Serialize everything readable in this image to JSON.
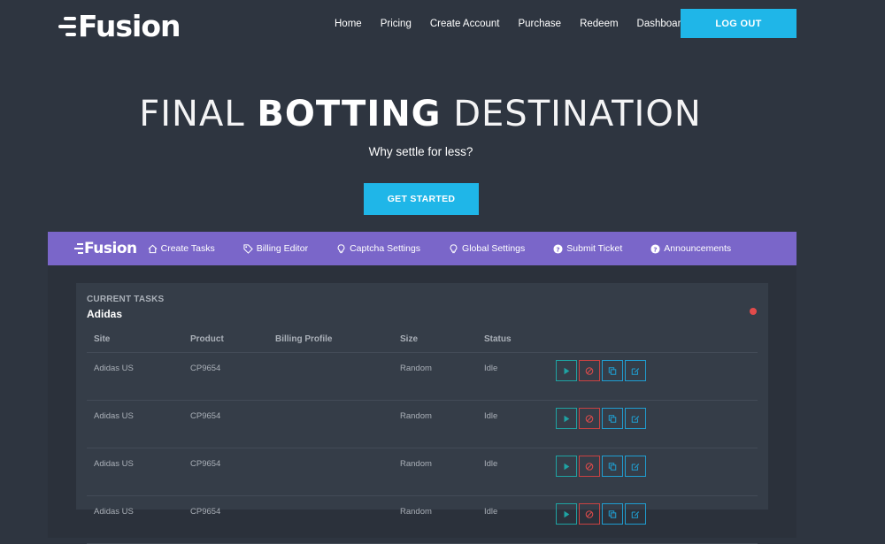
{
  "brand": {
    "name": "Fusion"
  },
  "nav": {
    "links": [
      "Home",
      "Pricing",
      "Create Account",
      "Purchase",
      "Redeem",
      "Dashboard"
    ],
    "logout_label": "LOG OUT"
  },
  "hero": {
    "title_pre": "FINAL ",
    "title_bold": "BOTTING",
    "title_post": " DESTINATION",
    "subtitle": "Why settle for less?",
    "cta_label": "GET STARTED"
  },
  "app": {
    "brand": "Fusion",
    "tabs": [
      {
        "label": "Create Tasks",
        "icon": "home-icon"
      },
      {
        "label": "Billing Editor",
        "icon": "tags-icon"
      },
      {
        "label": "Captcha Settings",
        "icon": "lightbulb-icon"
      },
      {
        "label": "Global Settings",
        "icon": "lightbulb-icon"
      },
      {
        "label": "Submit Ticket",
        "icon": "question-circle-icon"
      },
      {
        "label": "Announcements",
        "icon": "question-circle-icon"
      }
    ],
    "card": {
      "label": "CURRENT TASKS",
      "title": "Adidas",
      "status_color": "#e24b4b",
      "columns": [
        "Site",
        "Product",
        "Billing Profile",
        "Size",
        "Status"
      ],
      "rows": [
        {
          "site": "Adidas US",
          "product": "CP9654",
          "billing": "",
          "size": "Random",
          "status": "Idle"
        },
        {
          "site": "Adidas US",
          "product": "CP9654",
          "billing": "",
          "size": "Random",
          "status": "Idle"
        },
        {
          "site": "Adidas US",
          "product": "CP9654",
          "billing": "",
          "size": "Random",
          "status": "Idle"
        },
        {
          "site": "Adidas US",
          "product": "CP9654",
          "billing": "",
          "size": "Random",
          "status": "Idle"
        }
      ],
      "actions": [
        "play-icon",
        "stop-icon",
        "copy-icon",
        "edit-icon"
      ]
    }
  },
  "colors": {
    "background": "#2e3540",
    "accent": "#1fb6e8",
    "app_bar": "#7a66c9",
    "play": "#1fa3a3",
    "stop": "#c94242"
  }
}
